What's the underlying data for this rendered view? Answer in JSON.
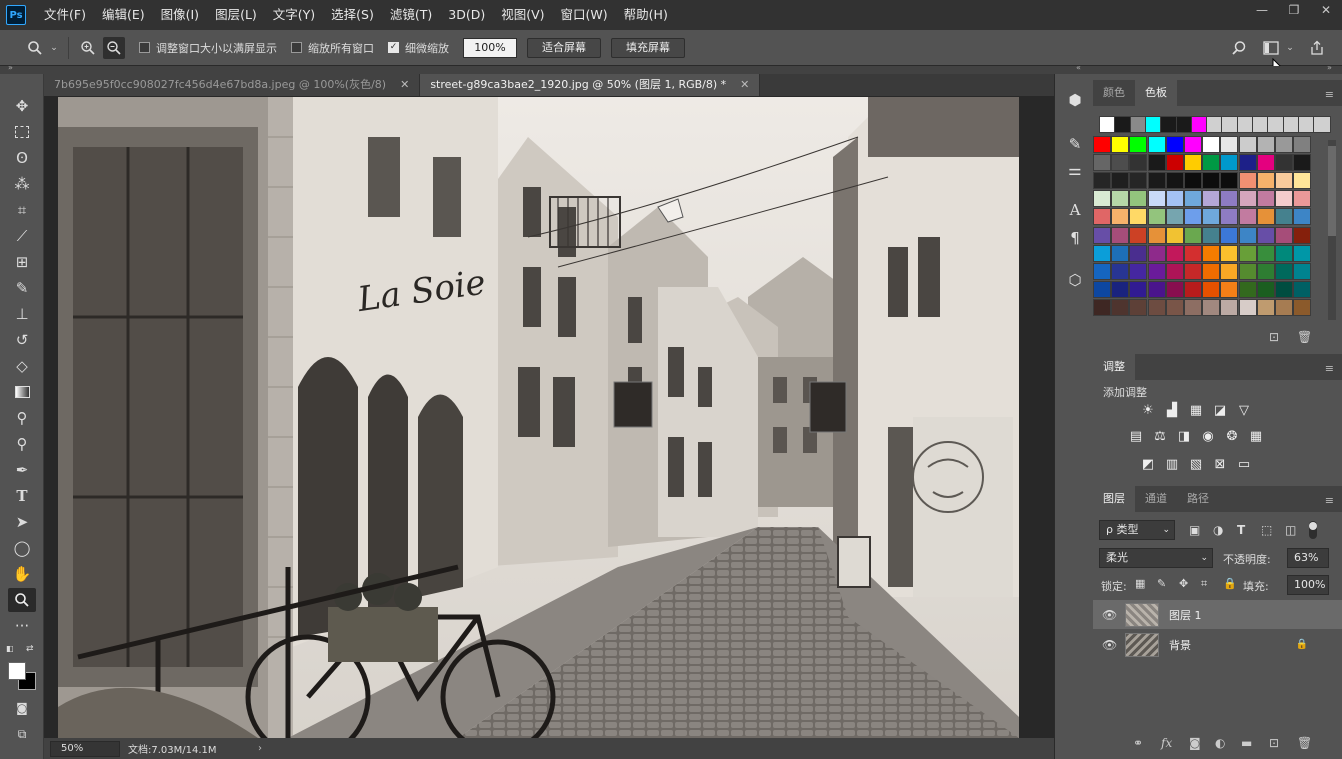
{
  "app": {
    "logo": "Ps"
  },
  "menu": [
    "文件(F)",
    "编辑(E)",
    "图像(I)",
    "图层(L)",
    "文字(Y)",
    "选择(S)",
    "滤镜(T)",
    "3D(D)",
    "视图(V)",
    "窗口(W)",
    "帮助(H)"
  ],
  "window_controls": {
    "minimize": "—",
    "restore": "❐",
    "close": "✕"
  },
  "options": {
    "resize_windows": "调整窗口大小以满屏显示",
    "zoom_all": "缩放所有窗口",
    "scrubby_zoom": "细微缩放",
    "scrubby_checked": true,
    "zoom_value": "100%",
    "fit_screen": "适合屏幕",
    "fill_screen": "填充屏幕"
  },
  "tabs": [
    {
      "label": "7b695e95f0cc908027fc456d4e67bd8a.jpeg @ 100%(灰色/8)",
      "active": false
    },
    {
      "label": "street-g89ca3bae2_1920.jpg @ 50% (图层 1, RGB/8) *",
      "active": true
    }
  ],
  "photo": {
    "sign_text": "La Soie"
  },
  "status": {
    "zoom": "50%",
    "doc_info": "文档:7.03M/14.1M"
  },
  "swatches_panel": {
    "tabs": [
      "颜色",
      "色板"
    ],
    "active_tab": "色板",
    "recent": [
      "#ffffff",
      "#1a1a1a",
      "#8a8a8a",
      "#00ffff",
      "#1a1a1a",
      "#1a1a1a",
      "#ff00ff",
      "#d0d0d0",
      "#d0d0d0",
      "#d0d0d0",
      "#d0d0d0",
      "#d0d0d0",
      "#d0d0d0",
      "#d0d0d0",
      "#d0d0d0"
    ],
    "rows": [
      [
        "#ff0000",
        "#ffff00",
        "#00ff00",
        "#00ffff",
        "#0000ff",
        "#ff00ff",
        "#ffffff",
        "#e6e6e6",
        "#cccccc",
        "#b3b3b3",
        "#999999",
        "#808080"
      ],
      [
        "#666666",
        "#4d4d4d",
        "#333333",
        "#1a1a1a",
        "#cc0000",
        "#ffcc00",
        "#009944",
        "#0099cc",
        "#1d2088",
        "#e4007f",
        "#333333",
        "#1a1a1a"
      ],
      [
        "#262626",
        "#1f1f1f",
        "#262626",
        "#1a1a1a",
        "#141414",
        "#0d0d0d",
        "#0d0d0d",
        "#0d0d0d",
        "#f19072",
        "#f6b26b",
        "#f9cb9c",
        "#ffe599"
      ],
      [
        "#d9ead3",
        "#b6d7a8",
        "#93c47d",
        "#c9daf8",
        "#a4c2f4",
        "#6fa8dc",
        "#b4a7d6",
        "#8e7cc3",
        "#d5a6bd",
        "#c27ba0",
        "#f4cccc",
        "#ea9999"
      ],
      [
        "#e06666",
        "#f6b26b",
        "#ffd966",
        "#93c47d",
        "#76a5af",
        "#6d9eeb",
        "#6fa8dc",
        "#8e7cc3",
        "#c27ba0",
        "#e69138",
        "#45818e",
        "#3d85c6"
      ],
      [
        "#674ea7",
        "#a64d79",
        "#cc4125",
        "#e69138",
        "#f1c232",
        "#6aa84f",
        "#45818e",
        "#3c78d8",
        "#3d85c6",
        "#674ea7",
        "#a64d79",
        "#85200c"
      ],
      [
        "#0b9ed9",
        "#1d6fb8",
        "#4a2e8f",
        "#8e2a8b",
        "#c2185b",
        "#d32f2f",
        "#f57c00",
        "#fbc02d",
        "#689f38",
        "#388e3c",
        "#00897b",
        "#0097a7"
      ],
      [
        "#1565c0",
        "#283593",
        "#4527a0",
        "#6a1b9a",
        "#ad1457",
        "#c62828",
        "#ef6c00",
        "#f9a825",
        "#558b2f",
        "#2e7d32",
        "#00695c",
        "#00838f"
      ],
      [
        "#0d47a1",
        "#1a237e",
        "#311b92",
        "#4a148c",
        "#880e4f",
        "#b71c1c",
        "#e65100",
        "#f57f17",
        "#33691e",
        "#1b5e20",
        "#004d40",
        "#006064"
      ],
      [
        "#3e2723",
        "#4e342e",
        "#5d4037",
        "#6d4c41",
        "#795548",
        "#8d6e63",
        "#a1887f",
        "#bcaaa4",
        "#d7ccc8",
        "#bf9b6f",
        "#a67c52",
        "#8b5a2b"
      ]
    ]
  },
  "adjustments": {
    "title": "调整",
    "subtitle": "添加调整"
  },
  "layers_panel": {
    "tabs": [
      "图层",
      "通道",
      "路径"
    ],
    "active_tab": "图层",
    "filter": "ρ 类型",
    "blend_mode": "柔光",
    "opacity_label": "不透明度:",
    "opacity": "63%",
    "lock_label": "锁定:",
    "fill_label": "填充:",
    "fill": "100%",
    "layers": [
      {
        "name": "图层 1",
        "selected": true,
        "locked": false
      },
      {
        "name": "背景",
        "selected": false,
        "locked": true
      }
    ]
  }
}
